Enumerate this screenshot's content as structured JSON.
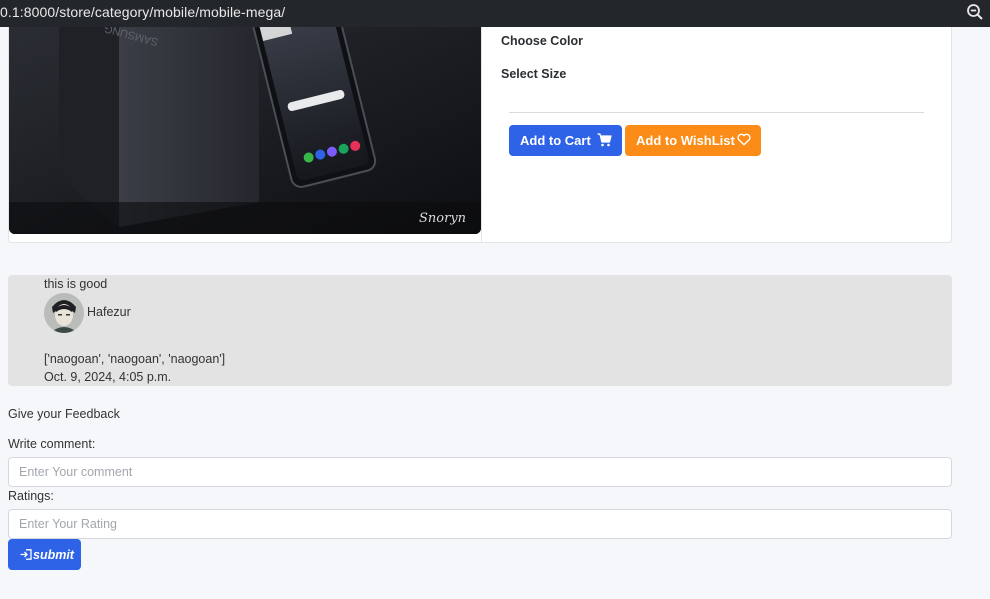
{
  "browser": {
    "url": "0.1:8000/store/category/mobile/mobile-mega/",
    "zoom_icon": "zoom-out-icon"
  },
  "product": {
    "image_watermark": "Snoryn",
    "box_brand": "SAMSUNG",
    "choose_color_label": "Choose Color",
    "select_size_label": "Select Size",
    "add_to_cart_label": "Add to Cart",
    "add_to_cart_icon": "cart-icon",
    "add_to_wishlist_label": "Add to WishList",
    "add_to_wishlist_icon": "heart-icon",
    "colors": {
      "cart_button": "#2e63e8",
      "wishlist_button": "#fb8c17"
    }
  },
  "review": {
    "comment": "this is good",
    "user_name": "Hafezur",
    "tags": "['naogoan', 'naogoan', 'naogoan']",
    "date": "Oct. 9, 2024, 4:05 p.m."
  },
  "feedback": {
    "title": "Give your Feedback",
    "comment_label": "Write comment:",
    "comment_placeholder": "Enter Your comment",
    "rating_label": "Ratings:",
    "rating_placeholder": "Enter Your Rating",
    "submit_label": "submit",
    "submit_icon": "sign-in-icon"
  }
}
